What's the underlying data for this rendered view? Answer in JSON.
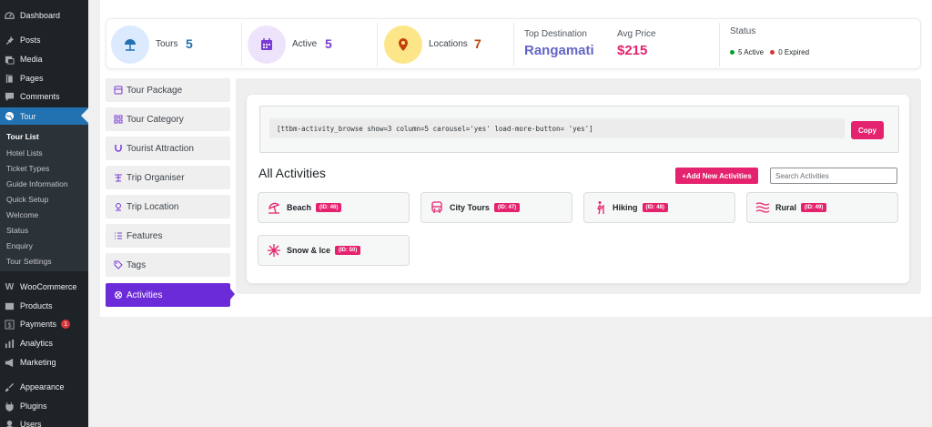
{
  "wp_menu": {
    "dashboard": "Dashboard",
    "posts": "Posts",
    "media": "Media",
    "pages": "Pages",
    "comments": "Comments",
    "tour": "Tour",
    "woocommerce": "WooCommerce",
    "products": "Products",
    "payments": "Payments",
    "payments_badge": "1",
    "analytics": "Analytics",
    "marketing": "Marketing",
    "appearance": "Appearance",
    "plugins": "Plugins",
    "users": "Users"
  },
  "tour_submenu": [
    "Tour List",
    "Hotel Lists",
    "Ticket Types",
    "Guide Information",
    "Quick Setup",
    "Welcome",
    "Status",
    "Enquiry",
    "Tour Settings"
  ],
  "stats": {
    "tours_label": "Tours",
    "tours_value": "5",
    "active_label": "Active",
    "active_value": "5",
    "locations_label": "Locations",
    "locations_value": "7",
    "top_destination_label": "Top Destination",
    "top_destination_value": "Rangamati",
    "avg_price_label": "Avg Price",
    "avg_price_value": "$215",
    "status_label": "Status",
    "status_active": "5 Active",
    "status_expired": "0 Expired"
  },
  "tabs": [
    "Tour Package",
    "Tour Category",
    "Tourist Attraction",
    "Trip Organiser",
    "Trip Location",
    "Features",
    "Tags",
    "Activities"
  ],
  "content": {
    "shortcode": "[ttbm-activity_browse show=3 column=5 carousel='yes' load-more-button= 'yes']",
    "copy_label": "Copy",
    "section_title": "All Activities",
    "add_label": "+Add New Activities",
    "search_placeholder": "Search Activities"
  },
  "activities": [
    {
      "name": "Beach",
      "id": "(ID: 46)",
      "icon": "beach-icon"
    },
    {
      "name": "City Tours",
      "id": "(ID: 47)",
      "icon": "city-bus-icon"
    },
    {
      "name": "Hiking",
      "id": "(ID: 48)",
      "icon": "hiking-icon"
    },
    {
      "name": "Rural",
      "id": "(ID: 49)",
      "icon": "rural-icon"
    },
    {
      "name": "Snow & Ice",
      "id": "(ID: 50)",
      "icon": "snowflake-icon"
    }
  ],
  "colors": {
    "wp_sidebar": "#1d2327",
    "wp_active": "#2271b1",
    "accent_pink": "#e5226e",
    "accent_purple": "#6c2bd9",
    "tours_circle": "#dbeafe",
    "active_circle": "#ede4fb",
    "locations_circle": "#fde68a",
    "status_green": "#00a32a",
    "status_red": "#d63638"
  }
}
